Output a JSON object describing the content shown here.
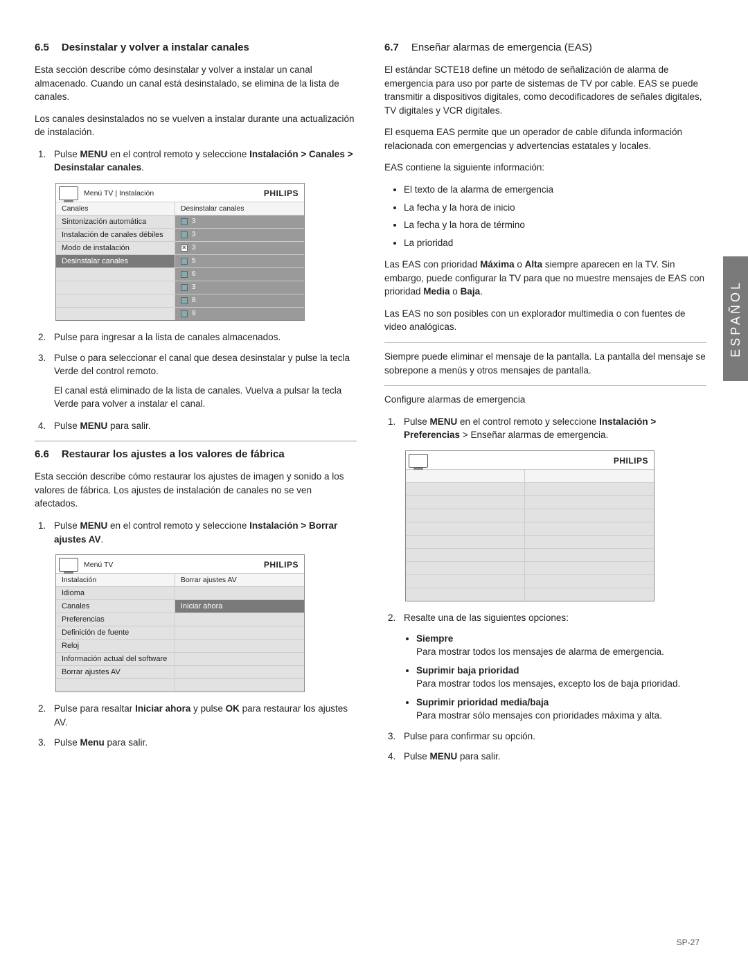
{
  "side_tab": "ESPAÑOL",
  "page_number": "SP-27",
  "left": {
    "s65": {
      "num": "6.5",
      "title": "Desinstalar y volver a instalar canales",
      "p1": "Esta sección describe cómo desinstalar y volver a instalar un canal almacenado. Cuando un canal está desinstalado, se elimina de la lista de canales.",
      "p2": "Los canales desinstalados no se vuelven a instalar durante una actualización de instalación.",
      "li1a": "Pulse ",
      "li1b": "MENU",
      "li1c": " en el control remoto y seleccione ",
      "li1d": "Instalación > Canales > Desinstalar canales",
      "li1e": ".",
      "li2": "Pulse  para ingresar a la lista de canales almacenados.",
      "li3": "Pulse   o    para seleccionar el canal que desea desinstalar y pulse la tecla Verde del control remoto.",
      "li3b": "El canal está eliminado de la lista de canales. Vuelva a pulsar la tecla Verde para volver a instalar el canal.",
      "li4a": "Pulse ",
      "li4b": "MENU",
      "li4c": " para salir."
    },
    "s66": {
      "num": "6.6",
      "title": "Restaurar los ajustes a los valores de fábrica",
      "p1": "Esta sección describe cómo restaurar los ajustes de imagen y sonido a los valores de fábrica. Los ajustes de instalación de canales no se ven afectados.",
      "li1a": "Pulse ",
      "li1b": "MENU",
      "li1c": " en el control remoto y seleccione ",
      "li1d": "Instalación > Borrar ajustes AV",
      "li1e": ".",
      "li2a": "Pulse  para resaltar    ",
      "li2b": "Iniciar ahora",
      "li2c": " y pulse ",
      "li2d": "OK",
      "li2e": " para restaurar los ajustes AV.",
      "li3a": "Pulse ",
      "li3b": "Menu",
      "li3c": " para salir."
    },
    "menu1": {
      "brand": "PHILIPS",
      "crumb": "Menú TV | Instalación",
      "subL": "Canales",
      "subR": "Desinstalar canales",
      "rows": [
        {
          "l": "Sintonización automática",
          "n": "3"
        },
        {
          "l": "Instalación de canales débiles",
          "n": "3"
        },
        {
          "l": "Modo de instalación",
          "n": "3",
          "x": true
        },
        {
          "l": "Desinstalar canales",
          "n": "5",
          "sel": true
        },
        {
          "l": "",
          "n": "6"
        },
        {
          "l": "",
          "n": "3"
        },
        {
          "l": "",
          "n": "8"
        },
        {
          "l": "",
          "n": "9"
        }
      ]
    },
    "menu2": {
      "brand": "PHILIPS",
      "crumb": "Menú TV",
      "subL": "Instalación",
      "subR": "Borrar ajustes AV",
      "rows": [
        {
          "l": "Idioma",
          "r": ""
        },
        {
          "l": "Canales",
          "r": "Iniciar ahora",
          "selR": true
        },
        {
          "l": "Preferencias",
          "r": ""
        },
        {
          "l": "Definición de fuente",
          "r": ""
        },
        {
          "l": "Reloj",
          "r": ""
        },
        {
          "l": "Información actual del software",
          "r": ""
        },
        {
          "l": "Borrar ajustes AV",
          "r": ""
        },
        {
          "l": "",
          "r": ""
        }
      ]
    }
  },
  "right": {
    "s67": {
      "num": "6.7",
      "title": "Enseñar alarmas de emergencia (EAS)",
      "p1": "El estándar SCTE18 define un método de señalización de alarma de emergencia para uso por parte de sistemas de TV por cable. EAS se puede transmitir a dispositivos digitales, como decodificadores de señales digitales, TV digitales y VCR digitales.",
      "p2": "El esquema EAS permite que un operador de cable difunda información relacionada con emergencias y advertencias estatales y locales.",
      "p3": "EAS contiene la siguiente información:",
      "bul": [
        "El texto de la alarma de emergencia",
        "La fecha y la hora de inicio",
        "La fecha y la hora de término",
        "La prioridad"
      ],
      "p4a": "Las EAS con prioridad ",
      "p4b": "Máxima",
      "p4c": " o ",
      "p4d": "Alta",
      "p4e": " siempre aparecen en la TV. Sin embargo, puede configurar la TV para que no muestre mensajes de EAS con prioridad ",
      "p4f": "Media",
      "p4g": " o ",
      "p4h": "Baja",
      "p4i": ".",
      "p5": "Las EAS no son posibles con un explorador multimedia o con fuentes de video analógicas.",
      "p6": "Siempre puede eliminar el mensaje de la pantalla. La pantalla del mensaje se sobrepone a menús y otros mensajes de pantalla.",
      "p7": "Configure alarmas de emergencia",
      "li1a": "Pulse ",
      "li1b": "MENU",
      "li1c": " en el control remoto y seleccione ",
      "li1d": "Instalación > Preferencias",
      "li1e": " > Enseñar   alarmas    de  emergencia.",
      "li2": "Resalte una de las siguientes opciones:",
      "opts": [
        {
          "t": "Siempre",
          "d": "Para mostrar todos los mensajes de alarma de emergencia."
        },
        {
          "t": "Suprimir baja prioridad",
          "d": "Para mostrar todos los mensajes, excepto los de baja prioridad."
        },
        {
          "t": "Suprimir prioridad media/baja",
          "d": "Para mostrar sólo mensajes con prioridades máxima y alta."
        }
      ],
      "li3": "Pulse  para confirmar su opción.",
      "li4a": "Pulse ",
      "li4b": "MENU",
      "li4c": " para salir."
    },
    "menu3": {
      "brand": "PHILIPS",
      "rows_count": 10
    }
  }
}
